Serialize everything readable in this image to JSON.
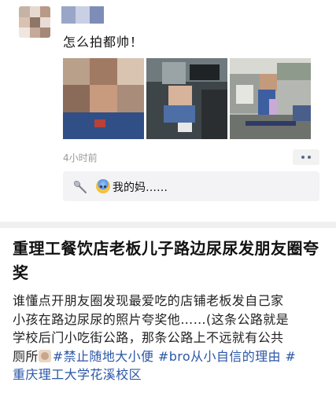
{
  "post": {
    "text": "怎么拍都帅！",
    "timestamp": "4小时前",
    "comment": {
      "text": "我的妈……",
      "icons": [
        "spoon-icon",
        "fearful-face-emoji"
      ]
    },
    "photos": [
      {
        "name": "photo-child-closeup",
        "icon": "blurred-photo"
      },
      {
        "name": "photo-child-sitting-street",
        "icon": "blurred-photo"
      },
      {
        "name": "photo-child-roadside",
        "icon": "blurred-photo"
      }
    ]
  },
  "article": {
    "title": "重理工餐饮店老板儿子路边尿尿发朋友圈夸奖",
    "body_lines": [
      "谁懂点开朋友圈发现最爱吃的店铺老板发自己家",
      "小孩在路边尿尿的照片夸奖他……(这条公路就是",
      "学校后门小吃街公路，那条公路上不远就有公共",
      "厕所"
    ],
    "tag_1": "#禁止随地大小便",
    "tag_2": "#bro从小自信的理由",
    "tag_3": "#",
    "tag_4": "重庆理工大学花溪校区"
  },
  "colors": {
    "hashtag": "#2b57a8",
    "timestamp": "#9a9a9a",
    "comment_bg": "#f3f3f5",
    "divider": "#f0f0f0"
  }
}
